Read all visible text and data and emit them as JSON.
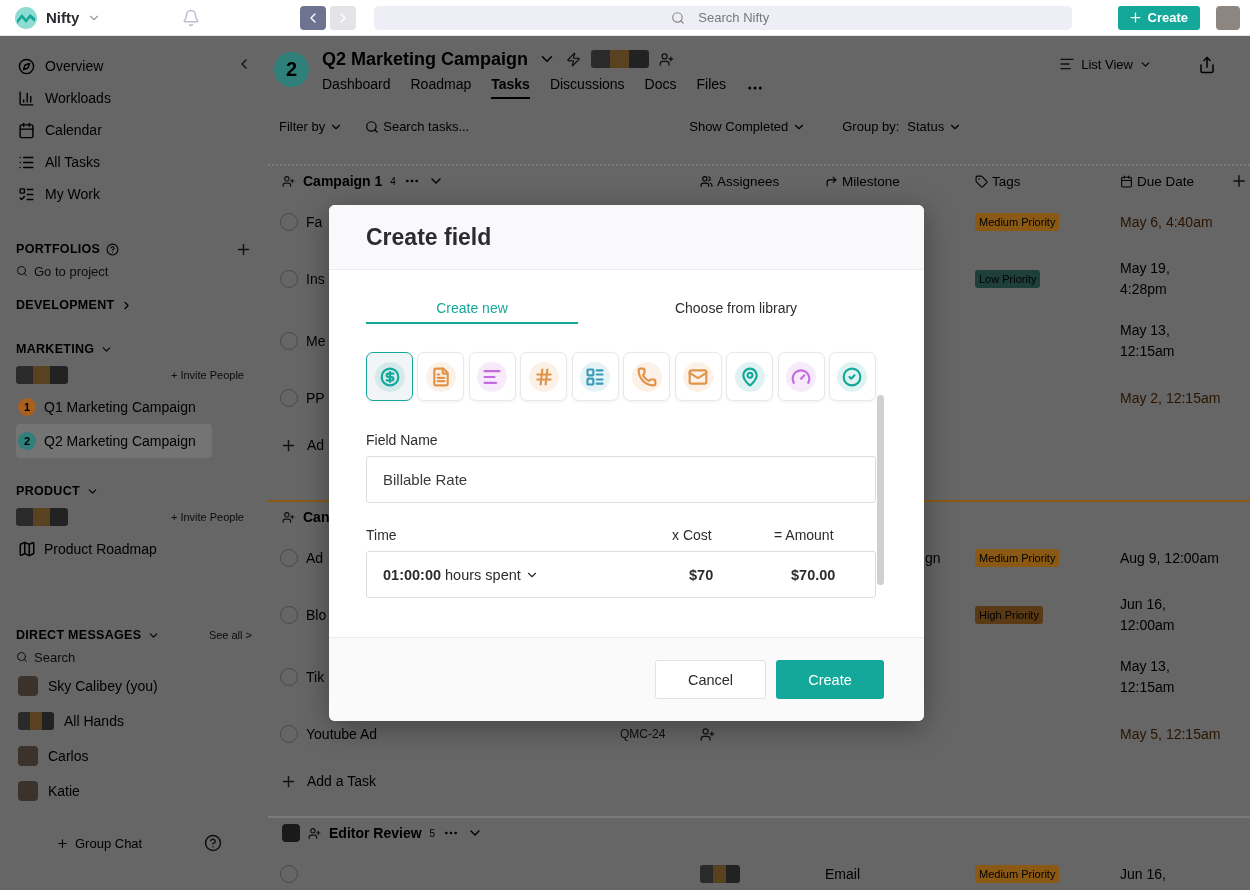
{
  "topbar": {
    "brand": "Nifty",
    "nav": [
      {
        "kind": "back",
        "disabled": false
      },
      {
        "kind": "forward",
        "disabled": true
      }
    ],
    "search": {
      "placeholder": "Search Nifty"
    },
    "create": "Create"
  },
  "sidebar": {
    "nav": [
      {
        "kind": "overview",
        "label": "Overview"
      },
      {
        "kind": "workloads",
        "label": "Workloads"
      },
      {
        "kind": "calendar",
        "label": "Calendar"
      },
      {
        "kind": "all_tasks",
        "label": "All Tasks"
      },
      {
        "kind": "my_work",
        "label": "My Work"
      }
    ],
    "portfolios": {
      "title": "PORTFOLIOS",
      "search": {
        "placeholder": "Go to project"
      }
    },
    "groups": [
      {
        "title": "DEVELOPMENT",
        "expanded": false
      },
      {
        "title": "MARKETING",
        "expanded": true,
        "invite": "+ Invite People",
        "projects": [
          {
            "kind": "numbered",
            "badge": "1",
            "label": "Q1 Marketing Campaign",
            "color": "#a8601e",
            "selected": false
          },
          {
            "kind": "numbered",
            "badge": "2",
            "label": "Q2 Marketing Campaign",
            "color": "#2f7f7a",
            "selected": true
          }
        ]
      },
      {
        "title": "PRODUCT",
        "expanded": true,
        "invite": "+ Invite People",
        "projects": [
          {
            "kind": "roadmap",
            "label": "Product Roadmap",
            "selected": false
          }
        ]
      }
    ],
    "direct_messages": {
      "title": "DIRECT MESSAGES",
      "see_all": "See all >",
      "search": {
        "placeholder": "Search"
      },
      "people": [
        {
          "kind": "single",
          "name": "Sky Calibey (you)"
        },
        {
          "kind": "group",
          "name": "All Hands"
        },
        {
          "kind": "single",
          "name": "Carlos"
        },
        {
          "kind": "single",
          "name": "Katie"
        }
      ]
    },
    "group_chat": "Group Chat"
  },
  "project": {
    "badge": "2",
    "title": "Q2 Marketing Campaign",
    "tabs": [
      {
        "label": "Dashboard",
        "selected": false
      },
      {
        "label": "Roadmap",
        "selected": false
      },
      {
        "label": "Tasks",
        "selected": true
      },
      {
        "label": "Discussions",
        "selected": false
      },
      {
        "label": "Docs",
        "selected": false
      },
      {
        "label": "Files",
        "selected": false
      }
    ],
    "view": "List View"
  },
  "toolbar": {
    "filter": "Filter by",
    "search": {
      "placeholder": "Search tasks..."
    },
    "show_completed": "Show Completed",
    "group_by_label": "Group by:",
    "group_by_value": "Status"
  },
  "columns": [
    "Assignees",
    "Milestone",
    "Tags",
    "Due Date"
  ],
  "task_groups": [
    {
      "name": "Campaign 1",
      "count": "4",
      "color": "#7a7a7a",
      "owner_avatar": false,
      "add_label": "Ad",
      "tasks": [
        {
          "name": "Fa",
          "done": false,
          "tag": {
            "label": "Medium Priority",
            "color": "#8a5a14"
          },
          "due": "May 6, 4:40am",
          "overdue": true
        },
        {
          "name": "Ins",
          "done": false,
          "tag": {
            "label": "Low Priority",
            "color": "#1f3f3b"
          },
          "due": "May 19,\n4:28pm",
          "overdue": false
        },
        {
          "name": "Me",
          "done": false,
          "due": "May 13,\n12:15am",
          "overdue": false
        },
        {
          "name": "PP",
          "done": false,
          "due": "May 2, 12:15am",
          "overdue": true
        }
      ]
    },
    {
      "name": "Can",
      "color": "#8a5a14",
      "owner_avatar": false,
      "add_label": "Add a Task",
      "tasks": [
        {
          "name": "Ad",
          "done": false,
          "milestone_tail": "gn",
          "tag": {
            "label": "Medium Priority",
            "color": "#8a5a14"
          },
          "due": "Aug 9, 12:00am",
          "overdue": false
        },
        {
          "name": "Blo",
          "done": false,
          "tag": {
            "label": "High Priority",
            "color": "#5a3a14"
          },
          "due": "Jun 16,\n12:00am",
          "overdue": false
        },
        {
          "name": "Tik",
          "done": false,
          "due": "May 13,\n12:15am",
          "overdue": false
        },
        {
          "name": "Youtube Ad",
          "done": false,
          "id": "QMC-24",
          "has_assignees": false,
          "due": "May 5, 12:15am",
          "overdue": true
        }
      ]
    },
    {
      "name": "Editor Review",
      "count": "5",
      "color": "#7a7a7a",
      "owner_avatar": true,
      "tasks": [
        {
          "done": false,
          "has_assignees": true,
          "milestone": "Email",
          "tag": {
            "label": "Medium Priority",
            "color": "#8a5a14"
          },
          "due": "Jun 16,",
          "overdue": false
        }
      ]
    }
  ],
  "modal": {
    "title": "Create field",
    "tabs": [
      {
        "label": "Create new",
        "selected": true
      },
      {
        "label": "Choose from library",
        "selected": false
      }
    ],
    "field_types": [
      {
        "kind": "currency",
        "color": "#14a89a",
        "selected": true
      },
      {
        "kind": "document",
        "color": "#e0944a",
        "selected": false
      },
      {
        "kind": "text",
        "color": "#c46be0",
        "selected": false
      },
      {
        "kind": "number",
        "color": "#e0944a",
        "selected": false
      },
      {
        "kind": "form",
        "color": "#3a9bb8",
        "selected": false
      },
      {
        "kind": "phone",
        "color": "#e0944a",
        "selected": false
      },
      {
        "kind": "email",
        "color": "#e0944a",
        "selected": false
      },
      {
        "kind": "location",
        "color": "#14a89a",
        "selected": false
      },
      {
        "kind": "progress",
        "color": "#c46be0",
        "selected": false
      },
      {
        "kind": "checkbox",
        "color": "#14a89a",
        "selected": false
      }
    ],
    "field_name": {
      "label": "Field Name",
      "value": "Billable Rate"
    },
    "calc": {
      "time_label": "Time",
      "cost_label": "x Cost",
      "amount_label": "= Amount",
      "time_value": "01:00:00",
      "time_unit": "hours spent",
      "cost": "$70",
      "amount": "$70.00"
    },
    "buttons": [
      {
        "kind": "secondary",
        "label": "Cancel"
      },
      {
        "kind": "primary",
        "label": "Create"
      }
    ]
  }
}
